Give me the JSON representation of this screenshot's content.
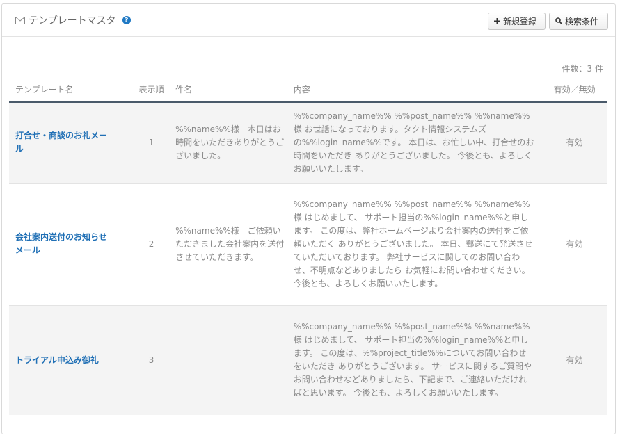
{
  "header": {
    "title": "テンプレートマスタ",
    "help_label": "?",
    "new_button_label": "新規登録",
    "search_button_label": "検索条件"
  },
  "count": {
    "label": "件数：3 件"
  },
  "table": {
    "columns": [
      "テンプレート名",
      "表示順",
      "件名",
      "内容",
      "有効／無効"
    ],
    "rows": [
      {
        "name": "打合せ・商談のお礼メール",
        "order": "1",
        "subject": "%%name%%様　本日はお時間をいただきありがとうございました。",
        "body": "%%company_name%% %%post_name%% %%name%%様 お世話になっております。タクト情報システムズの%%login_name%%です。 本日は、お忙しい中、打合せのお時間をいただき ありがとうございました。 今後とも、よろしくお願いいたします。",
        "status": "有効"
      },
      {
        "name": "会社案内送付のお知らせメール",
        "order": "2",
        "subject": "%%name%%様　ご依頼いただきました会社案内を送付させていただきます。",
        "body": "%%company_name%% %%post_name%% %%name%%様 はじめまして、 サポート担当の%%login_name%%と申します。 この度は、弊社ホームページより会社案内の送付をご依頼いただく ありがとうございました。 本日、郵送にて発送させていただいております。 弊社サービスに関してのお問い合わせ、不明点などありましたら お気軽にお問い合わせください。 今後とも、よろしくお願いいたします。",
        "status": "有効"
      },
      {
        "name": "トライアル申込み御礼",
        "order": "3",
        "subject": "",
        "body": "%%company_name%% %%post_name%% %%name%%様 はじめまして、 サポート担当の%%login_name%%と申します。 この度は、%%project_title%%についてお問い合わせをいただき ありがとうございます。 サービスに関するご質問やお問い合わせなどありましたら、下記まで、ご連絡いただければと思います。 今後とも、よろしくお願いいたします。",
        "status": "有効"
      }
    ]
  },
  "colors": {
    "accent": "#1f6fb5",
    "help_icon": "#1f79c4",
    "header_rule": "#4a5a6a",
    "stripe": "#f4f4f4"
  },
  "icons": {
    "title": "envelope-icon",
    "new": "plus-icon",
    "search": "search-icon"
  }
}
